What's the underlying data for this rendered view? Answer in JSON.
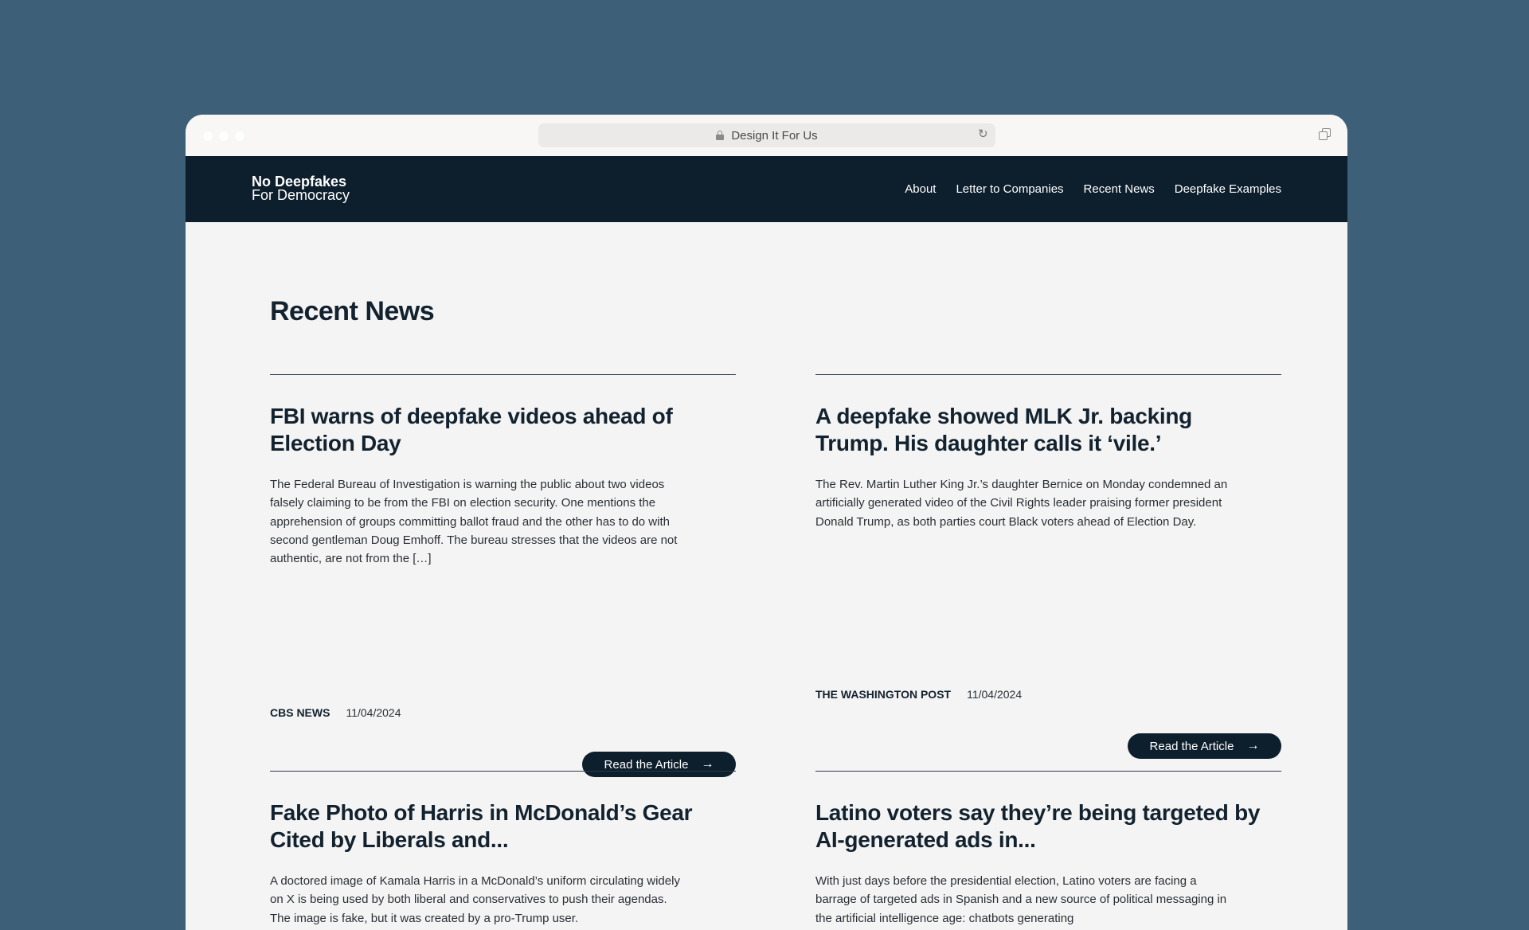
{
  "browser": {
    "url_label": "Design It For Us"
  },
  "site": {
    "logo_line1": "No Deepfakes",
    "logo_line2": "For Democracy",
    "nav": [
      {
        "label": "About"
      },
      {
        "label": "Letter to Companies"
      },
      {
        "label": "Recent News"
      },
      {
        "label": "Deepfake Examples"
      }
    ]
  },
  "main": {
    "title": "Recent News",
    "read_label": "Read the Article",
    "articles": [
      {
        "headline": "FBI warns of deepfake videos ahead of Election Day",
        "summary": "The Federal Bureau of Investigation is warning the public about two videos falsely claiming to be from the FBI on election security. One mentions the apprehension of groups committing ballot fraud and the other has to do with second gentleman Doug Emhoff. The bureau stresses that the videos are not authentic, are not from the […]",
        "source": "CBS NEWS",
        "date": "11/04/2024"
      },
      {
        "headline": "A deepfake showed MLK Jr. backing Trump. His daughter calls it ‘vile.’",
        "summary": "The Rev. Martin Luther King Jr.’s daughter Bernice on Monday condemned an artificially generated video of the Civil Rights leader praising former president Donald Trump, as both parties court Black voters ahead of Election Day.",
        "source": "THE WASHINGTON POST",
        "date": "11/04/2024"
      },
      {
        "headline": "Fake Photo of Harris in McDonald’s Gear Cited by Liberals and...",
        "summary": "A doctored image of Kamala Harris in a McDonald’s uniform circulating widely on X is being used by both liberal and conservatives to push their agendas. The image is fake, but it was created by a pro-Trump user."
      },
      {
        "headline": "Latino voters say they’re being targeted by AI-generated ads in...",
        "summary": "With just days before the presidential election, Latino voters are facing a barrage of targeted ads in Spanish and a new source of political messaging in the artificial intelligence age: chatbots generating"
      }
    ]
  }
}
